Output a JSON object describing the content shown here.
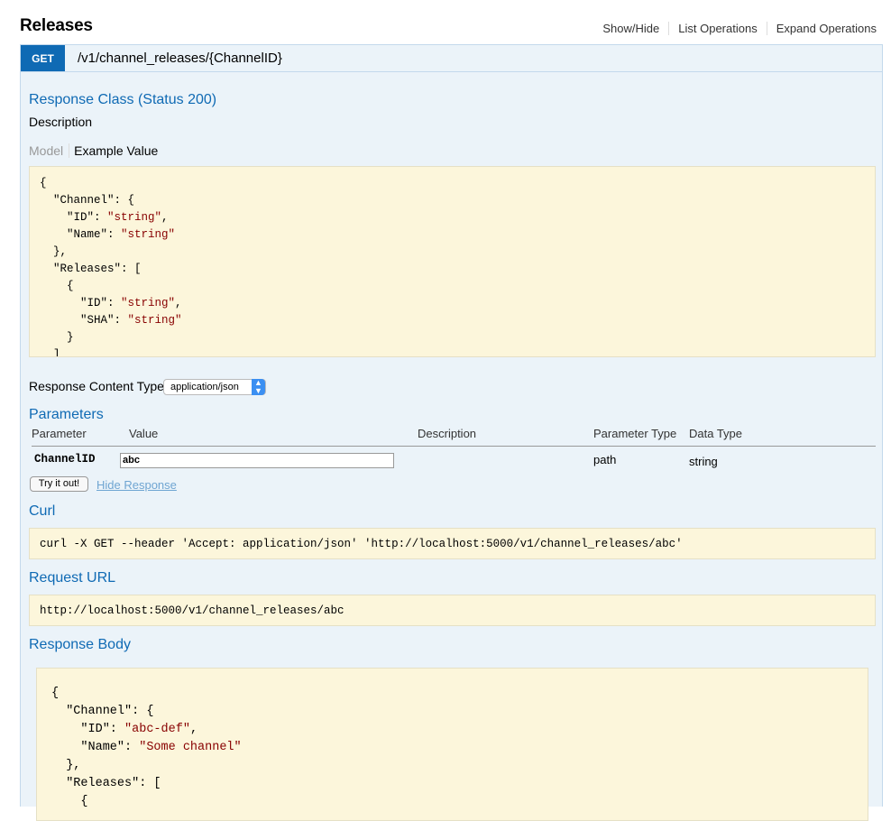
{
  "section": {
    "title": "Releases",
    "ops": [
      "Show/Hide",
      "List Operations",
      "Expand Operations"
    ]
  },
  "endpoint": {
    "method": "GET",
    "path": "/v1/channel_releases/{ChannelID}"
  },
  "response_class": {
    "heading": "Response Class (Status 200)",
    "description_label": "Description",
    "tabs": {
      "model": "Model",
      "example": "Example Value"
    },
    "example_lines": [
      "{",
      "  \"Channel\": {",
      "    \"ID\": \"string\",",
      "    \"Name\": \"string\"",
      "  },",
      "  \"Releases\": [",
      "    {",
      "      \"ID\": \"string\",",
      "      \"SHA\": \"string\"",
      "    }",
      "  ]"
    ]
  },
  "content_type": {
    "label": "Response Content Type",
    "selected": "application/json"
  },
  "parameters": {
    "heading": "Parameters",
    "columns": [
      "Parameter",
      "Value",
      "Description",
      "Parameter Type",
      "Data Type"
    ],
    "rows": [
      {
        "name": "ChannelID",
        "value": "abc",
        "description": "",
        "param_type": "path",
        "data_type": "string"
      }
    ]
  },
  "actions": {
    "try_label": "Try it out!",
    "hide_label": "Hide Response"
  },
  "curl": {
    "heading": "Curl",
    "command": "curl -X GET --header 'Accept: application/json' 'http://localhost:5000/v1/channel_releases/abc'"
  },
  "request_url": {
    "heading": "Request URL",
    "url": "http://localhost:5000/v1/channel_releases/abc"
  },
  "response_body": {
    "heading": "Response Body",
    "lines": [
      "{",
      "  \"Channel\": {",
      "    \"ID\": \"abc-def\",",
      "    \"Name\": \"Some channel\"",
      "  },",
      "  \"Releases\": [",
      "    {"
    ]
  }
}
